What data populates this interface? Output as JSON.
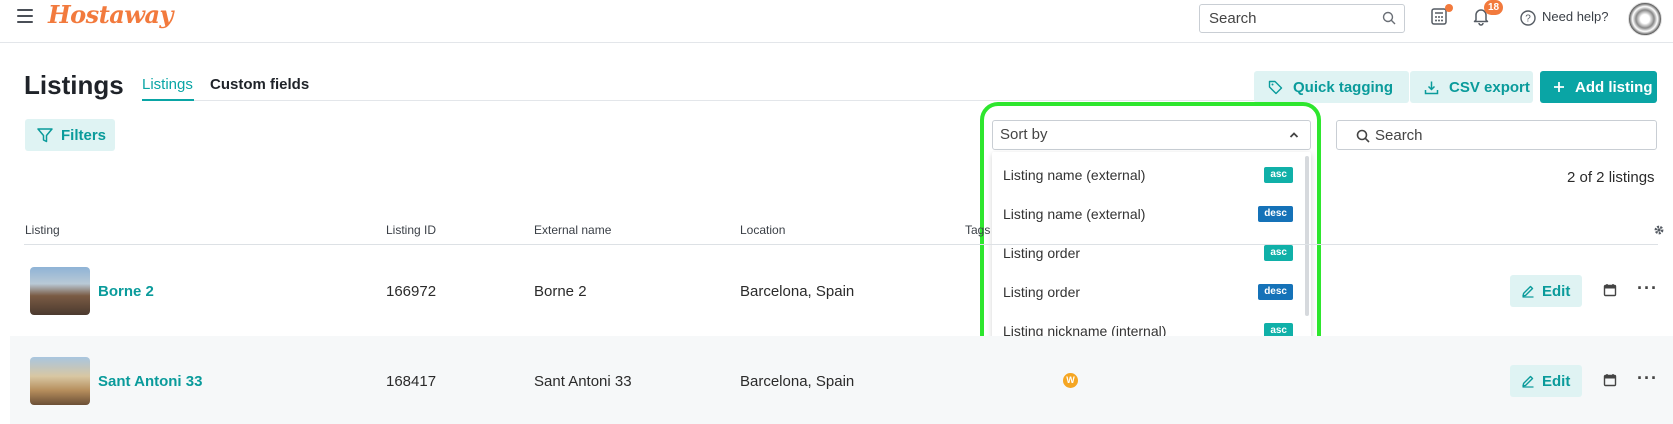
{
  "header": {
    "logo": "Hostaway",
    "search_placeholder": "Search",
    "notifications_count": "18",
    "help_label": "Need help?"
  },
  "page": {
    "title": "Listings",
    "tabs": [
      {
        "label": "Listings",
        "active": true
      },
      {
        "label": "Custom fields",
        "active": false
      }
    ]
  },
  "actions": {
    "quick_tagging": "Quick tagging",
    "csv_export": "CSV export",
    "add_listing": "Add listing",
    "filters": "Filters"
  },
  "sort": {
    "placeholder": "Sort by",
    "options": [
      {
        "label": "Listing name (external)",
        "dir": "asc"
      },
      {
        "label": "Listing name (external)",
        "dir": "desc"
      },
      {
        "label": "Listing order",
        "dir": "asc"
      },
      {
        "label": "Listing order",
        "dir": "desc"
      },
      {
        "label": "Listing nickname (internal)",
        "dir": "asc"
      }
    ]
  },
  "list_search_placeholder": "Search",
  "count_text": "2 of 2 listings",
  "table": {
    "columns": [
      "Listing",
      "Listing ID",
      "External name",
      "Location",
      "Tags"
    ],
    "rows": [
      {
        "name": "Borne 2",
        "id": "166972",
        "external_name": "Borne 2",
        "location": "Barcelona, Spain",
        "channel_badge": "",
        "edit": "Edit"
      },
      {
        "name": "Sant Antoni 33",
        "id": "168417",
        "external_name": "Sant Antoni 33",
        "location": "Barcelona, Spain",
        "channel_badge": "W",
        "edit": "Edit"
      }
    ]
  },
  "colors": {
    "accent": "#0aa5a5",
    "accent_light": "#dff3f3",
    "brand_orange": "#f27a3d",
    "asc_tag": "#10b0a8",
    "desc_tag": "#1572b8",
    "highlight": "#2ee62e"
  }
}
